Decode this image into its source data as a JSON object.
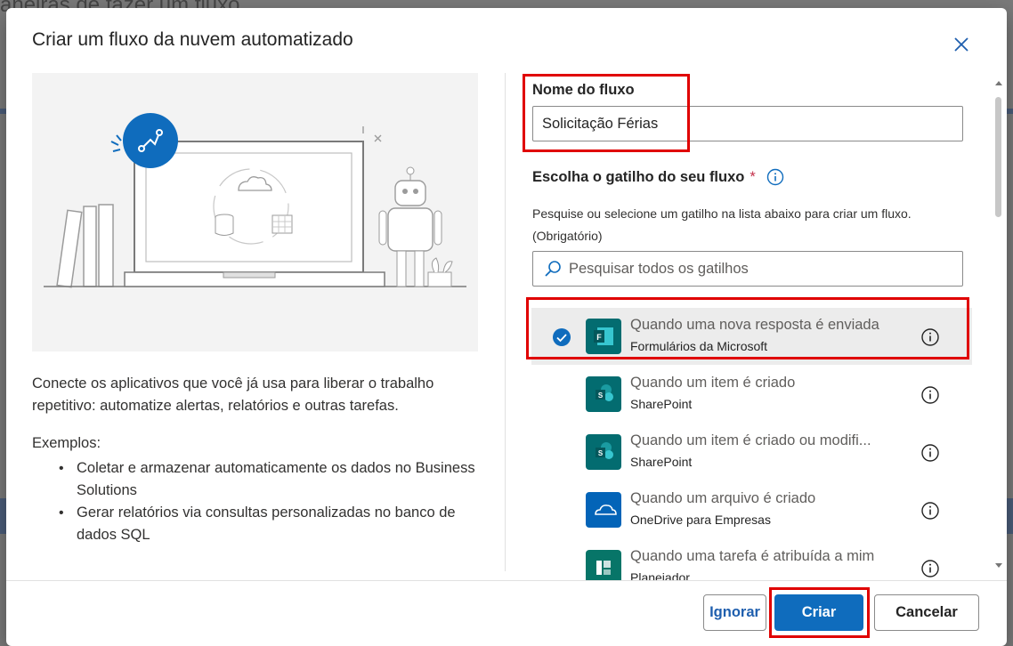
{
  "background_page": {
    "title_fragment": "aneiras de fazer um fluxo"
  },
  "dialog": {
    "title": "Criar um fluxo da nuvem automatizado",
    "description": "Conecte os aplicativos que você já usa para liberar o trabalho repetitivo: automatize alertas, relatórios e outras tarefas.",
    "examples_label": "Exemplos:",
    "examples": [
      "Coletar e armazenar automaticamente os dados no Business Solutions",
      "Gerar relatórios via consultas personalizadas no banco de dados SQL"
    ],
    "flow_name_label": "Nome do fluxo",
    "flow_name_value": "Solicitação Férias",
    "trigger_label": "Escolha o gatilho do seu fluxo",
    "required_mark": "*",
    "trigger_help": "Pesquise ou selecione um gatilho na lista abaixo para criar um fluxo. (Obrigatório)",
    "search_placeholder": "Pesquisar todos os gatilhos",
    "triggers": [
      {
        "title": "Quando uma nova resposta é enviada",
        "connector": "Formulários da Microsoft",
        "icon": "forms-icon",
        "color": "#036c70",
        "selected": true
      },
      {
        "title": "Quando um item é criado",
        "connector": "SharePoint",
        "icon": "sharepoint-icon",
        "color": "#036c70",
        "selected": false
      },
      {
        "title": "Quando um item é criado ou modifi...",
        "connector": "SharePoint",
        "icon": "sharepoint-icon",
        "color": "#036c70",
        "selected": false
      },
      {
        "title": "Quando um arquivo é criado",
        "connector": "OneDrive para Empresas",
        "icon": "onedrive-icon",
        "color": "#0364b8",
        "selected": false
      },
      {
        "title": "Quando uma tarefa é atribuída a mim",
        "connector": "Planejador",
        "icon": "planner-icon",
        "color": "#077568",
        "selected": false
      }
    ],
    "buttons": {
      "ignore": "Ignorar",
      "create": "Criar",
      "cancel": "Cancelar"
    }
  },
  "colors": {
    "accent": "#0f6cbd",
    "highlight": "#e00000"
  }
}
